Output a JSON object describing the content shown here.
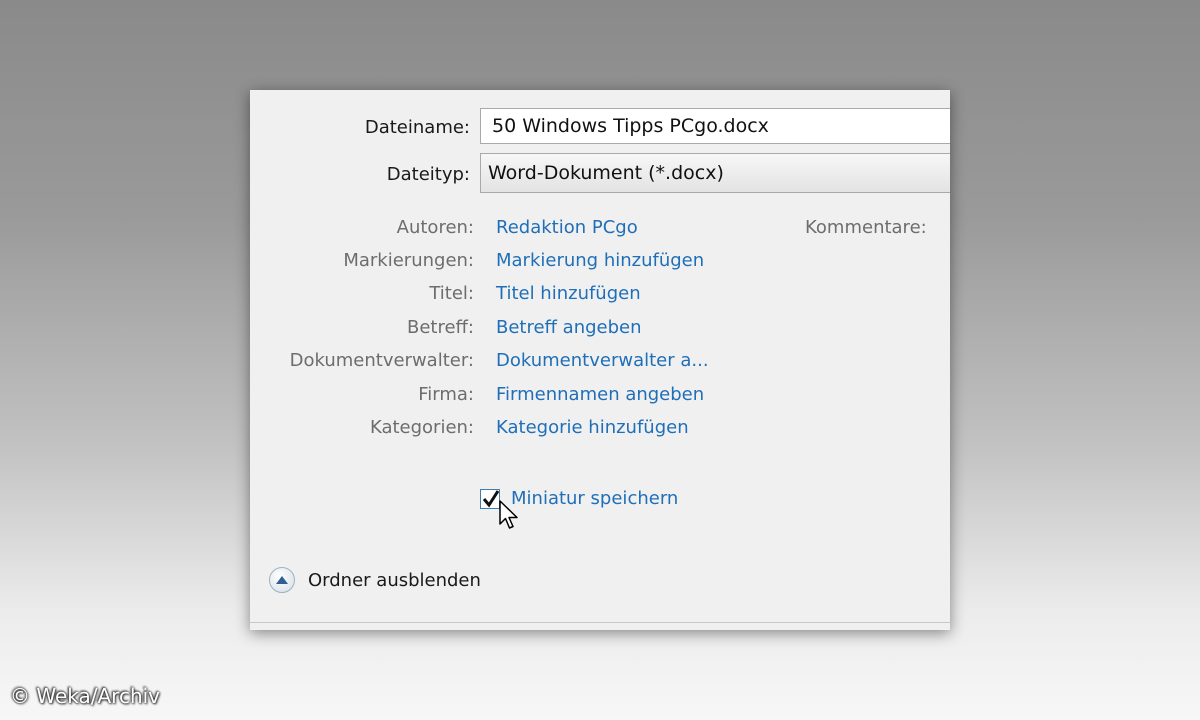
{
  "dialog": {
    "filename_label": "Dateiname:",
    "filename_value": "50 Windows Tipps PCgo.docx",
    "filetype_label": "Dateityp:",
    "filetype_value": "Word-Dokument (*.docx)",
    "metadata": [
      {
        "label": "Autoren:",
        "value": "Redaktion PCgo"
      },
      {
        "label": "Markierungen:",
        "value": "Markierung hinzufügen"
      },
      {
        "label": "Titel:",
        "value": "Titel hinzufügen"
      },
      {
        "label": "Betreff:",
        "value": "Betreff angeben"
      },
      {
        "label": "Dokumentverwalter:",
        "value": "Dokumentverwalter a..."
      },
      {
        "label": "Firma:",
        "value": "Firmennamen angeben"
      },
      {
        "label": "Kategorien:",
        "value": "Kategorie hinzufügen"
      }
    ],
    "comments_label": "Kommentare:",
    "thumbnail_label": "Miniatur speichern",
    "thumbnail_checked": true,
    "hide_folders_label": "Ordner ausblenden"
  },
  "watermark": "© Weka/Archiv",
  "colors": {
    "link": "#1f6fb8",
    "label_muted": "#6d6d6d",
    "dialog_bg": "#f0f0f0"
  },
  "icons": {
    "checkbox": "checkmark-icon",
    "cursor": "mouse-pointer-icon",
    "toggle": "chevron-up-circle-icon"
  }
}
